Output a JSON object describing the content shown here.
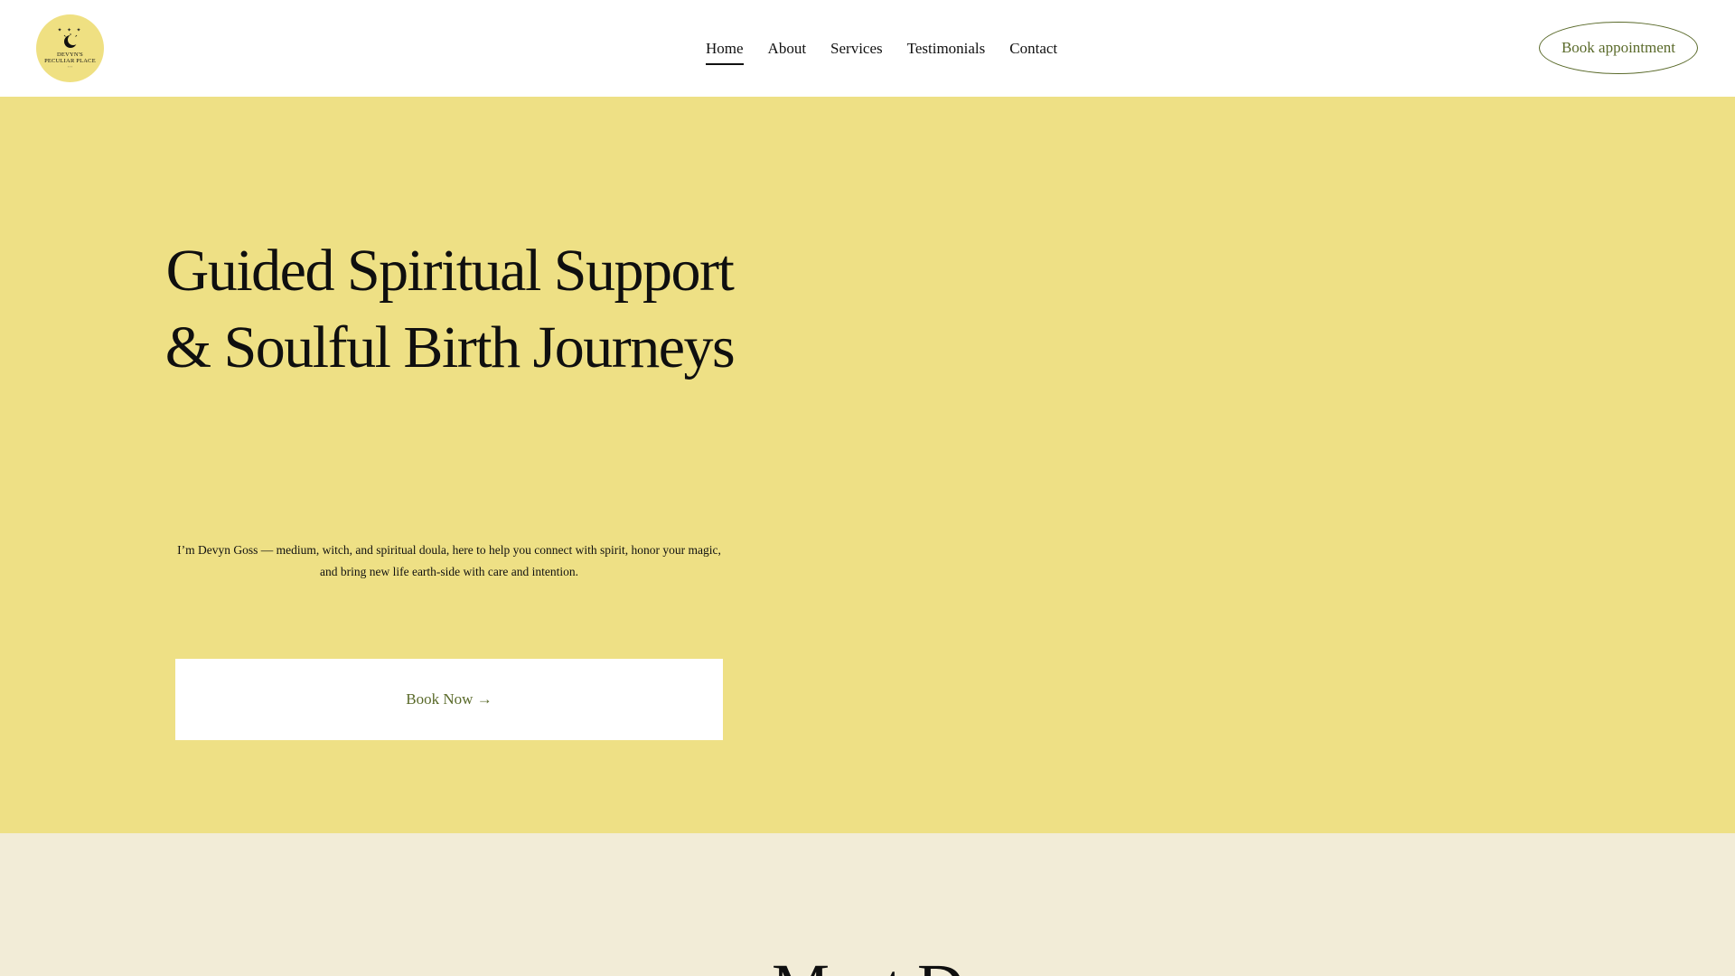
{
  "logo": {
    "name": "DEVYN'S PECULIAR PLACE",
    "icon": "crescent-moon-sun-icon",
    "color": "#efe082"
  },
  "nav": {
    "items": [
      {
        "label": "Home",
        "active": true
      },
      {
        "label": "About",
        "active": false
      },
      {
        "label": "Services",
        "active": false
      },
      {
        "label": "Testimonials",
        "active": false
      },
      {
        "label": "Contact",
        "active": false
      }
    ],
    "book_label": "Book appointment"
  },
  "hero": {
    "title": "Guided Spiritual Support & Soulful Birth Journeys",
    "subtitle": "I’m Devyn Goss — medium, witch, and spiritual doula, here to help you connect with spirit, honor your magic, and bring new life earth-side with care and intention.",
    "cta_label": "Book Now →",
    "background": "#eee085"
  },
  "about": {
    "title": "Meet D",
    "background": "#f2ecd7"
  },
  "colors": {
    "accent": "#5a6a2a",
    "header_bg": "#ffffff"
  }
}
